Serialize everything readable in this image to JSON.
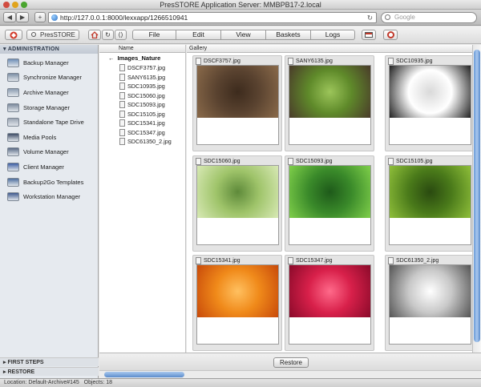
{
  "window": {
    "title": "PresSTORE Application Server: MMBPB17-2.local"
  },
  "browser": {
    "url": "http://127.0.0.1:8000/lexxapp/1266510941",
    "search_placeholder": "Google",
    "back_glyph": "◀",
    "forward_glyph": "▶",
    "add_glyph": "+",
    "reload_glyph": "↻"
  },
  "toolbar": {
    "app_label": "PresSTORE",
    "menus": [
      "File",
      "Edit",
      "View",
      "Baskets",
      "Logs"
    ]
  },
  "sidebar": {
    "section": "ADMINISTRATION",
    "items": [
      {
        "label": "Backup Manager",
        "icon": "backup-icon",
        "color": "#6f8fb7"
      },
      {
        "label": "Synchronize Manager",
        "icon": "sync-icon",
        "color": "#7d8fa6"
      },
      {
        "label": "Archive Manager",
        "icon": "archive-icon",
        "color": "#8b9bb0"
      },
      {
        "label": "Storage Manager",
        "icon": "storage-icon",
        "color": "#7c8a9c"
      },
      {
        "label": "Standalone Tape Drive",
        "icon": "tape-drive-icon",
        "color": "#9aa4b2"
      },
      {
        "label": "Media Pools",
        "icon": "media-pools-icon",
        "color": "#3e4c66"
      },
      {
        "label": "Volume Manager",
        "icon": "volume-icon",
        "color": "#5b6b86"
      },
      {
        "label": "Client Manager",
        "icon": "client-icon",
        "color": "#3d5fa4"
      },
      {
        "label": "Backup2Go Templates",
        "icon": "backup2go-icon",
        "color": "#4f6f9f"
      },
      {
        "label": "Workstation Manager",
        "icon": "workstation-icon",
        "color": "#3f5a8f"
      }
    ],
    "bottom": [
      "FIRST STEPS",
      "RESTORE"
    ]
  },
  "tree": {
    "column": "Name",
    "root": "Images_Nature",
    "files": [
      "DSCF3757.jpg",
      "SANY6135.jpg",
      "SDC10935.jpg",
      "SDC15060.jpg",
      "SDC15093.jpg",
      "SDC15105.jpg",
      "SDC15341.jpg",
      "SDC15347.jpg",
      "SDC61350_2.jpg"
    ]
  },
  "gallery": {
    "column": "Gallery",
    "items": [
      {
        "name": "DSCF3757.jpg",
        "colors": [
          "#5a4330",
          "#8a6a4a",
          "#3d2b1d"
        ]
      },
      {
        "name": "SANY6135.jpg",
        "colors": [
          "#5f8a2a",
          "#4a3b2a",
          "#9cc55a"
        ]
      },
      {
        "name": "SDC10935.jpg",
        "colors": [
          "#ffffff",
          "#222222",
          "#d9d9d9"
        ]
      },
      {
        "name": "SDC15060.jpg",
        "colors": [
          "#9fc46a",
          "#d8e9b5",
          "#5e8a3a"
        ]
      },
      {
        "name": "SDC15093.jpg",
        "colors": [
          "#3a8a2a",
          "#7fcf4a",
          "#1e5a1a"
        ]
      },
      {
        "name": "SDC15105.jpg",
        "colors": [
          "#4a7a1a",
          "#8fbf3a",
          "#2a4a10"
        ]
      },
      {
        "name": "SDC15341.jpg",
        "colors": [
          "#f08a1a",
          "#c84a0a",
          "#ffc060"
        ]
      },
      {
        "name": "SDC15347.jpg",
        "colors": [
          "#d8204a",
          "#8a0a2a",
          "#ff6a8a"
        ]
      },
      {
        "name": "SDC61350_2.jpg",
        "colors": [
          "#c8c8c8",
          "#555555",
          "#ffffff"
        ]
      }
    ]
  },
  "restore_label": "Restore",
  "status": {
    "location": "Location: Default-Archive#145",
    "objects": "Objects: 18"
  }
}
